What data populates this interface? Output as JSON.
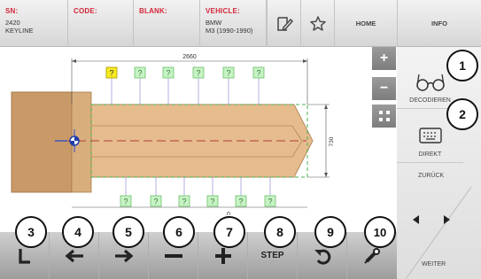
{
  "header": {
    "sn_label": "SN:",
    "sn_value": "2420\nKEYLINE",
    "code_label": "CODE:",
    "code_value": "",
    "blank_label": "BLANK:",
    "blank_value": "",
    "vehicle_label": "VEHICLE:",
    "vehicle_value": "BMW\nM3 (1990-1990)",
    "home_label": "HOME",
    "info_label": "INFO",
    "icons": [
      "notes-icon",
      "star-icon"
    ]
  },
  "drawing": {
    "width_dimension": "2660",
    "height_dimension": "730",
    "bottom_dimension_partial": "0",
    "top_cuts": [
      "?",
      "?",
      "?",
      "?",
      "?",
      "?",
      "?"
    ],
    "bottom_cuts": [
      "?",
      "?",
      "?",
      "?",
      "?",
      "?"
    ],
    "highlight_color": "#f7ea20",
    "cut_box_color": "#c6f3c4"
  },
  "zoom": {
    "plus": "+",
    "minus": "−",
    "fit_icon": "fit-icon"
  },
  "right_panel": {
    "decode_label": "DECODIEREN",
    "direct_label": "DIREKT",
    "back_label": "ZURÜCK",
    "next_label": "WEITER"
  },
  "toolbar": {
    "step_label": "STEP"
  },
  "callouts": [
    "1",
    "2",
    "3",
    "4",
    "5",
    "6",
    "7",
    "8",
    "9",
    "10"
  ],
  "colors": {
    "accent_red": "#d2273a",
    "blade": "#e6bc8e",
    "head": "#c99a67"
  }
}
